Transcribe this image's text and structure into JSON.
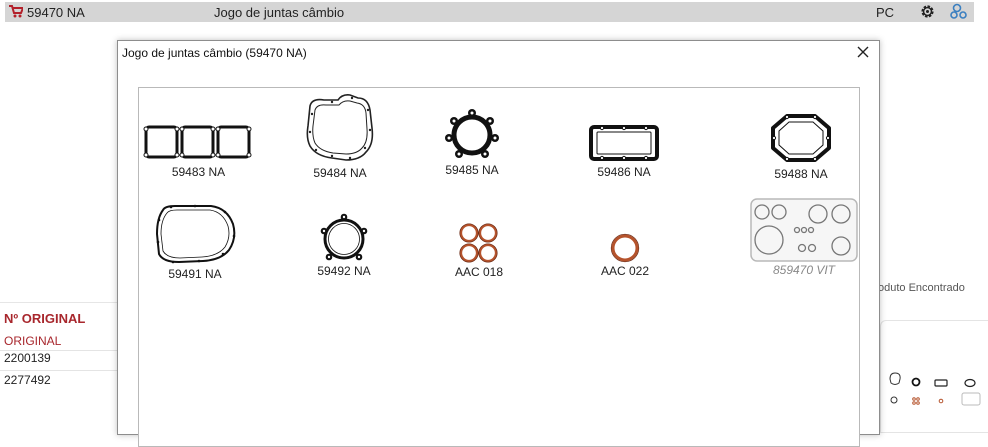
{
  "topbar": {
    "code": "59470 NA",
    "description": "Jogo de juntas câmbio",
    "unit": "PC",
    "icons": [
      "cart-icon",
      "gear-icon",
      "network-icon"
    ]
  },
  "background": {
    "found_text": "oduto Encontrado",
    "original_title": "Nº ORIGINAL",
    "original_column": "ORIGINAL",
    "original_codes": [
      "2200139",
      "2277492"
    ]
  },
  "modal": {
    "title": "Jogo de juntas câmbio (59470 NA)",
    "close_icon": "close-icon",
    "parts": [
      {
        "code": "59483 NA",
        "icon": "triple-square-gasket-icon"
      },
      {
        "code": "59484 NA",
        "icon": "housing-gasket-icon"
      },
      {
        "code": "59485 NA",
        "icon": "round-lug-gasket-icon"
      },
      {
        "code": "59486 NA",
        "icon": "rectangular-gasket-icon"
      },
      {
        "code": "59488 NA",
        "icon": "octagon-gasket-icon"
      },
      {
        "code": "59491 NA",
        "icon": "large-cover-gasket-icon"
      },
      {
        "code": "59492 NA",
        "icon": "ring-lug-gasket-icon"
      },
      {
        "code": "AAC 018",
        "icon": "o-ring-set-icon"
      },
      {
        "code": "AAC 022",
        "icon": "o-ring-icon"
      },
      {
        "code": "859470 VIT",
        "icon": "gasket-kit-icon"
      }
    ]
  },
  "colors": {
    "topbar_bg": "#d5d5d5",
    "brand_red": "#a8272d",
    "oring_copper": "#b5532c"
  }
}
